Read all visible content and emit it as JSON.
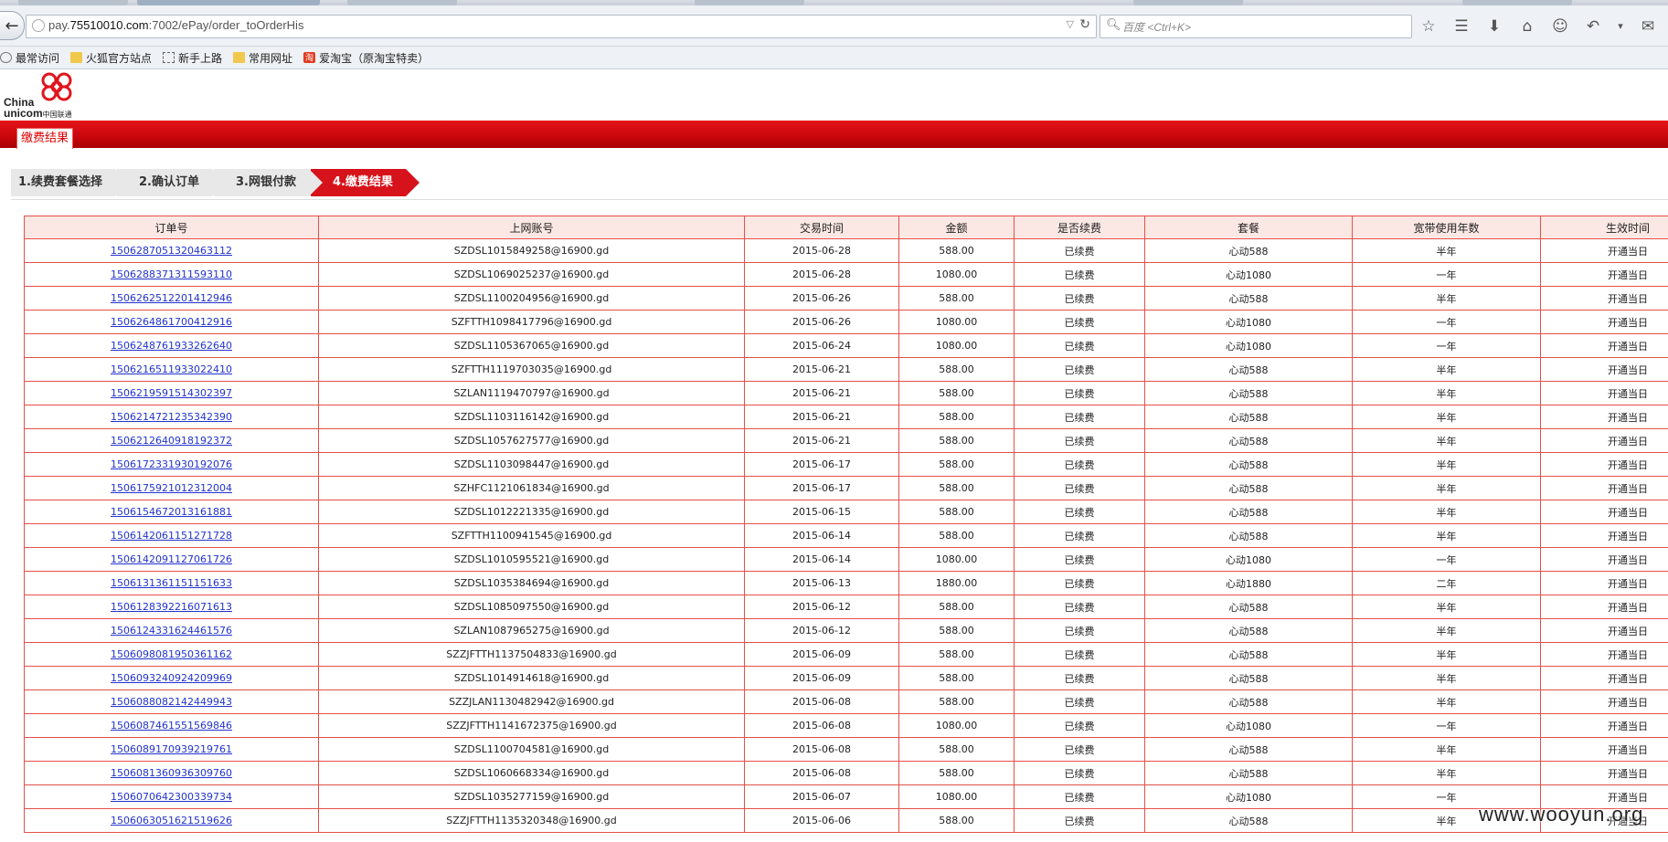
{
  "browser": {
    "url_prefix": "pay.",
    "url_domain": "75510010.com",
    "url_path": ":7002/ePay/order_toOrderHis",
    "search_placeholder": "百度 <Ctrl+K>",
    "bookmarks": [
      {
        "label": "最常访问",
        "icon": "gear"
      },
      {
        "label": "火狐官方站点",
        "icon": "folder"
      },
      {
        "label": "新手上路",
        "icon": "dash"
      },
      {
        "label": "常用网址",
        "icon": "folder"
      },
      {
        "label": "爱淘宝（原淘宝特卖）",
        "icon": "tao"
      }
    ]
  },
  "logo": {
    "line1": "China",
    "line2": "unicom",
    "cn": "中国联通"
  },
  "band_tab": "缴费结果",
  "steps": [
    {
      "label": "1.续费套餐选择",
      "active": false
    },
    {
      "label": "2.确认订单",
      "active": false
    },
    {
      "label": "3.网银付款",
      "active": false
    },
    {
      "label": "4.缴费结果",
      "active": true
    }
  ],
  "table": {
    "headers": [
      "订单号",
      "上网账号",
      "交易时间",
      "金额",
      "是否续费",
      "套餐",
      "宽带使用年数",
      "生效时间"
    ],
    "rows": [
      [
        "1506287051320463112",
        "SZDSL1015849258@16900.gd",
        "2015-06-28",
        "588.00",
        "已续费",
        "心动588",
        "半年",
        "开通当日"
      ],
      [
        "1506288371311593110",
        "SZDSL1069025237@16900.gd",
        "2015-06-28",
        "1080.00",
        "已续费",
        "心动1080",
        "一年",
        "开通当日"
      ],
      [
        "1506262512201412946",
        "SZDSL1100204956@16900.gd",
        "2015-06-26",
        "588.00",
        "已续费",
        "心动588",
        "半年",
        "开通当日"
      ],
      [
        "1506264861700412916",
        "SZFTTH1098417796@16900.gd",
        "2015-06-26",
        "1080.00",
        "已续费",
        "心动1080",
        "一年",
        "开通当日"
      ],
      [
        "1506248761933262640",
        "SZDSL1105367065@16900.gd",
        "2015-06-24",
        "1080.00",
        "已续费",
        "心动1080",
        "一年",
        "开通当日"
      ],
      [
        "1506216511933022410",
        "SZFTTH1119703035@16900.gd",
        "2015-06-21",
        "588.00",
        "已续费",
        "心动588",
        "半年",
        "开通当日"
      ],
      [
        "1506219591514302397",
        "SZLAN1119470797@16900.gd",
        "2015-06-21",
        "588.00",
        "已续费",
        "心动588",
        "半年",
        "开通当日"
      ],
      [
        "1506214721235342390",
        "SZDSL1103116142@16900.gd",
        "2015-06-21",
        "588.00",
        "已续费",
        "心动588",
        "半年",
        "开通当日"
      ],
      [
        "1506212640918192372",
        "SZDSL1057627577@16900.gd",
        "2015-06-21",
        "588.00",
        "已续费",
        "心动588",
        "半年",
        "开通当日"
      ],
      [
        "1506172331930192076",
        "SZDSL1103098447@16900.gd",
        "2015-06-17",
        "588.00",
        "已续费",
        "心动588",
        "半年",
        "开通当日"
      ],
      [
        "1506175921012312004",
        "SZHFC1121061834@16900.gd",
        "2015-06-17",
        "588.00",
        "已续费",
        "心动588",
        "半年",
        "开通当日"
      ],
      [
        "1506154672013161881",
        "SZDSL1012221335@16900.gd",
        "2015-06-15",
        "588.00",
        "已续费",
        "心动588",
        "半年",
        "开通当日"
      ],
      [
        "1506142061151271728",
        "SZFTTH1100941545@16900.gd",
        "2015-06-14",
        "588.00",
        "已续费",
        "心动588",
        "半年",
        "开通当日"
      ],
      [
        "1506142091127061726",
        "SZDSL1010595521@16900.gd",
        "2015-06-14",
        "1080.00",
        "已续费",
        "心动1080",
        "一年",
        "开通当日"
      ],
      [
        "1506131361151151633",
        "SZDSL1035384694@16900.gd",
        "2015-06-13",
        "1880.00",
        "已续费",
        "心动1880",
        "二年",
        "开通当日"
      ],
      [
        "1506128392216071613",
        "SZDSL1085097550@16900.gd",
        "2015-06-12",
        "588.00",
        "已续费",
        "心动588",
        "半年",
        "开通当日"
      ],
      [
        "1506124331624461576",
        "SZLAN1087965275@16900.gd",
        "2015-06-12",
        "588.00",
        "已续费",
        "心动588",
        "半年",
        "开通当日"
      ],
      [
        "1506098081950361162",
        "SZZJFTTH1137504833@16900.gd",
        "2015-06-09",
        "588.00",
        "已续费",
        "心动588",
        "半年",
        "开通当日"
      ],
      [
        "1506093240924209969",
        "SZDSL1014914618@16900.gd",
        "2015-06-09",
        "588.00",
        "已续费",
        "心动588",
        "半年",
        "开通当日"
      ],
      [
        "1506088082142449943",
        "SZZJLAN1130482942@16900.gd",
        "2015-06-08",
        "588.00",
        "已续费",
        "心动588",
        "半年",
        "开通当日"
      ],
      [
        "1506087461551569846",
        "SZZJFTTH1141672375@16900.gd",
        "2015-06-08",
        "1080.00",
        "已续费",
        "心动1080",
        "一年",
        "开通当日"
      ],
      [
        "1506089170939219761",
        "SZDSL1100704581@16900.gd",
        "2015-06-08",
        "588.00",
        "已续费",
        "心动588",
        "半年",
        "开通当日"
      ],
      [
        "1506081360936309760",
        "SZDSL1060668334@16900.gd",
        "2015-06-08",
        "588.00",
        "已续费",
        "心动588",
        "半年",
        "开通当日"
      ],
      [
        "1506070642300339734",
        "SZDSL1035277159@16900.gd",
        "2015-06-07",
        "1080.00",
        "已续费",
        "心动1080",
        "一年",
        "开通当日"
      ],
      [
        "1506063051621519626",
        "SZZJFTTH1135320348@16900.gd",
        "2015-06-06",
        "588.00",
        "已续费",
        "心动588",
        "半年",
        "开通当日"
      ]
    ]
  },
  "watermark": "www.wooyun.org"
}
